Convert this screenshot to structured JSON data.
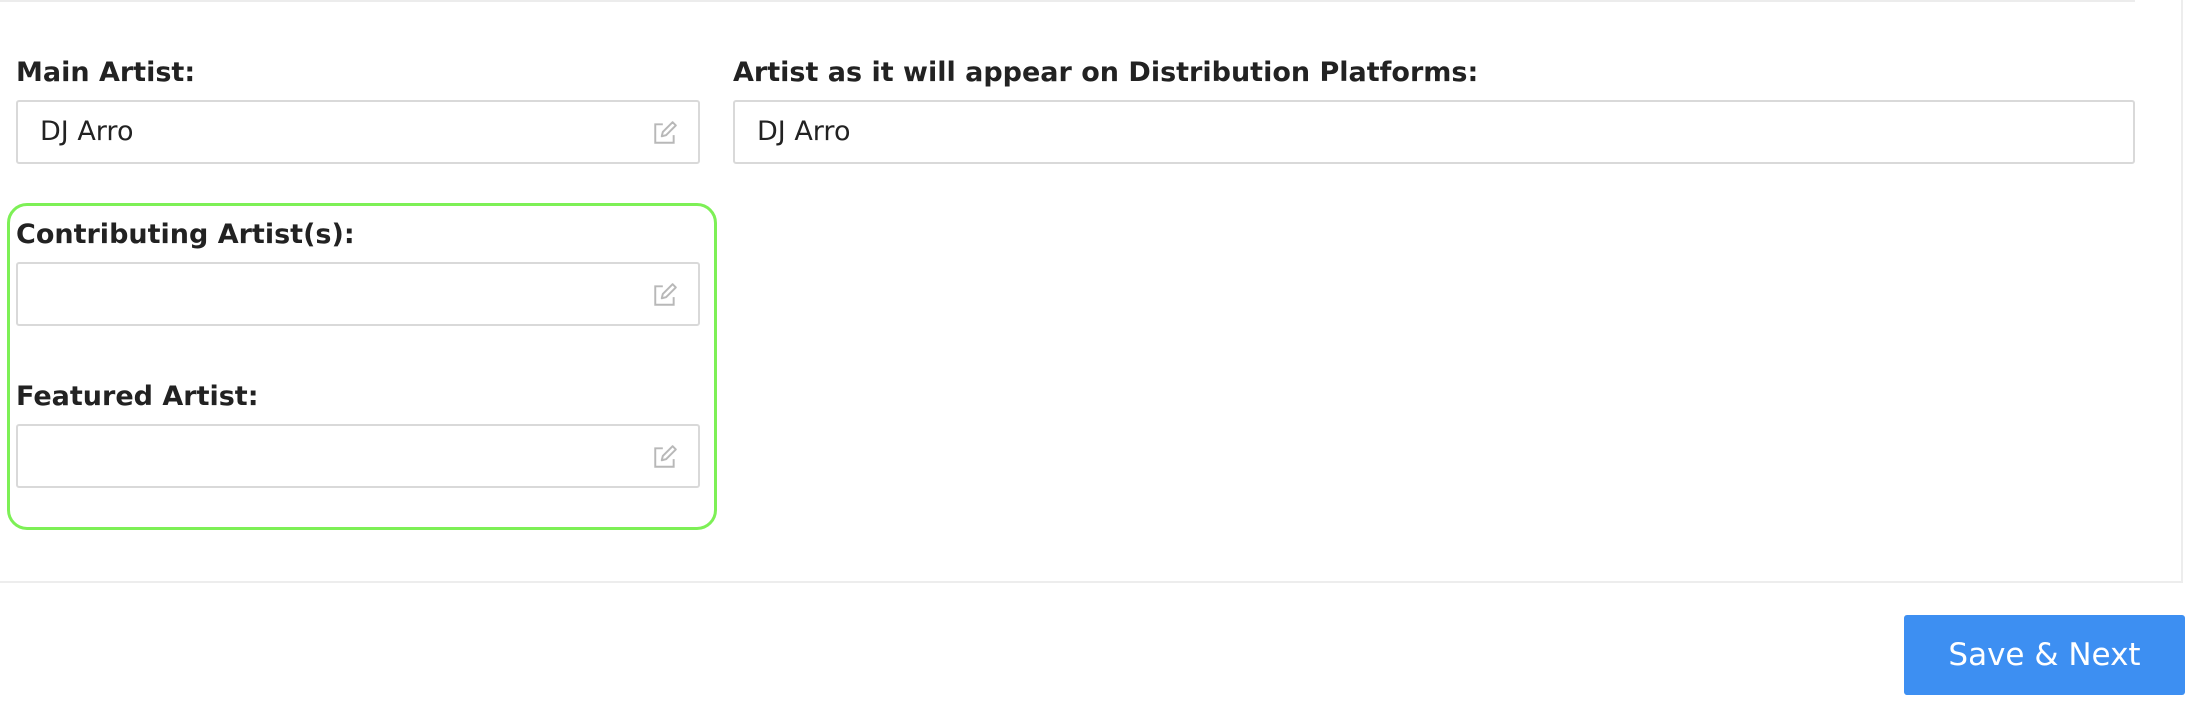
{
  "form": {
    "main_artist": {
      "label": "Main Artist:",
      "value": "DJ Arro",
      "icon": "edit-icon"
    },
    "distribution_artist": {
      "label": "Artist as it will appear on Distribution Platforms:",
      "value": "DJ Arro"
    },
    "contributing_artists": {
      "label": "Contributing Artist(s):",
      "value": "",
      "icon": "edit-icon"
    },
    "featured_artist": {
      "label": "Featured Artist:",
      "value": "",
      "icon": "edit-icon"
    }
  },
  "actions": {
    "save_next_label": "Save & Next"
  },
  "colors": {
    "primary_button": "#3d8ff2",
    "highlight_outline": "#7df056",
    "field_border": "#d9d9d9"
  }
}
